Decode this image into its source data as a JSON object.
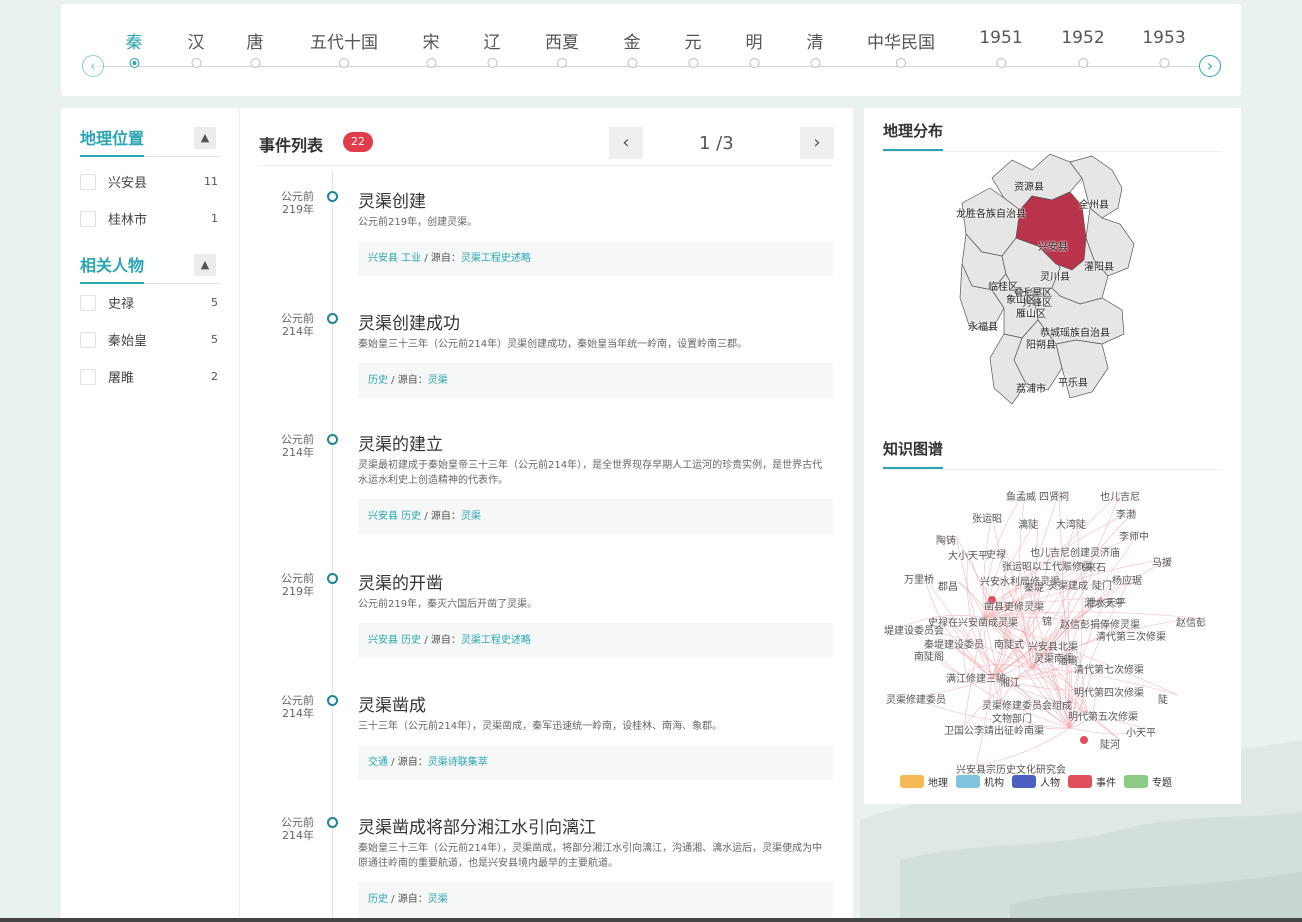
{
  "timeline": {
    "items": [
      "秦",
      "汉",
      "唐",
      "五代十国",
      "宋",
      "辽",
      "西夏",
      "金",
      "元",
      "明",
      "清",
      "中华民国",
      "1951",
      "1952",
      "1953"
    ],
    "active_index": 0,
    "prev_icon": "chevron-left-icon",
    "next_icon": "chevron-right-icon"
  },
  "facets": [
    {
      "title": "地理位置",
      "rows": [
        {
          "name": "兴安县",
          "count": "11"
        },
        {
          "name": "桂林市",
          "count": "1"
        }
      ]
    },
    {
      "title": "相关人物",
      "rows": [
        {
          "name": "史禄",
          "count": "5"
        },
        {
          "name": "秦始皇",
          "count": "5"
        },
        {
          "name": "屠睢",
          "count": "2"
        }
      ]
    }
  ],
  "events_panel": {
    "title": "事件列表",
    "badge": "22",
    "page": "1 /3",
    "prev": "‹",
    "next": "›",
    "events": [
      {
        "date_top": "公元前",
        "date_bottom": "219年",
        "name": "灵渠创建",
        "desc": "公元前219年，创建灵渠。",
        "tags": "兴安县 工业",
        "sep": " / 源自：",
        "source": "灵渠工程史述略"
      },
      {
        "date_top": "公元前",
        "date_bottom": "214年",
        "name": "灵渠创建成功",
        "desc": "秦始皇三十三年（公元前214年）灵渠创建成功，秦始皇当年统一岭南，设置岭南三郡。",
        "tags": "历史",
        "sep": " / 源自：",
        "source": "灵渠"
      },
      {
        "date_top": "公元前",
        "date_bottom": "214年",
        "name": "灵渠的建立",
        "desc": "灵渠最初建成于秦始皇帝三十三年（公元前214年），是全世界现存早期人工运河的珍贵实例，是世界古代水运水利史上创造精神的代表作。",
        "tags": "兴安县 历史",
        "sep": " / 源自：",
        "source": "灵渠"
      },
      {
        "date_top": "公元前",
        "date_bottom": "219年",
        "name": "灵渠的开凿",
        "desc": "公元前219年，秦灭六国后开凿了灵渠。",
        "tags": "兴安县 历史",
        "sep": " / 源自：",
        "source": "灵渠工程史述略"
      },
      {
        "date_top": "公元前",
        "date_bottom": "214年",
        "name": "灵渠凿成",
        "desc": "三十三年（公元前214年），灵渠凿成，秦军迅速统一岭南，设桂林、南海、象郡。",
        "tags": "交通",
        "sep": " / 源自：",
        "source": "灵渠诗联集萃"
      },
      {
        "date_top": "公元前",
        "date_bottom": "214年",
        "name": "灵渠凿成将部分湘江水引向漓江",
        "desc": "秦始皇三十三年（公元前214年），灵渠凿成，将部分湘江水引向漓江，沟通湘、漓水运后，灵渠便成为中原通往岭南的重要航道，也是兴安县境内最早的主要航道。",
        "tags": "历史",
        "sep": " / 源自：",
        "source": "灵渠"
      }
    ]
  },
  "geo_card": {
    "title": "地理分布",
    "highlight_color": "#b9344a",
    "regions": [
      "资源县",
      "全州县",
      "龙胜各族自治县",
      "兴安县",
      "灌阳县",
      "灵川县",
      "临桂区",
      "叠彩区",
      "秀峰区",
      "七星区",
      "象山区",
      "雁山区",
      "永福县",
      "恭城瑶族自治县",
      "阳朔县",
      "荔浦市",
      "平乐县"
    ]
  },
  "kg_card": {
    "title": "知识图谱",
    "nodes": [
      "鱼孟威",
      "四贤祠",
      "也儿吉尼",
      "张运昭",
      "漓陡",
      "大湾陡",
      "李渤",
      "陶铸",
      "李师中",
      "大小天平",
      "史禄",
      "也儿吉尼创建灵济庙",
      "马援",
      "张运昭以工代赈修渠",
      "飞来石",
      "万里桥",
      "郡昌",
      "兴安水利局修灵渠",
      "秦堤",
      "灵渠建成",
      "陡门",
      "杨应琚",
      "湘水天平",
      "凿县更修灵渠",
      "赵信彭",
      "史禄在兴安凿成灵渠",
      "锦",
      "赵信彭捐俸修灵渠",
      "堤建设委员会",
      "秦堤建设委员",
      "南陡式",
      "兴安县北渠",
      "清代第三次修渠",
      "南陡阁",
      "灵渠南渠",
      "潘瑜",
      "满江修建三陂",
      "清代第七次修渠",
      "湘江",
      "灵渠修建委员",
      "灵渠修建委员会组成",
      "明代第四次修渠",
      "陡",
      "文物部门",
      "明代第五次修渠",
      "泄水天平",
      "卫国公李靖出征岭南渠",
      "小天平",
      "陡河",
      "兴安县宗历史文化研究会"
    ],
    "legend": [
      {
        "label": "地理",
        "color": "#f2b955"
      },
      {
        "label": "机构",
        "color": "#7fc3dd"
      },
      {
        "label": "人物",
        "color": "#4a5fc1"
      },
      {
        "label": "事件",
        "color": "#e0505c"
      },
      {
        "label": "专题",
        "color": "#8bcb84"
      }
    ],
    "edge_color": "#f2a6ad"
  }
}
